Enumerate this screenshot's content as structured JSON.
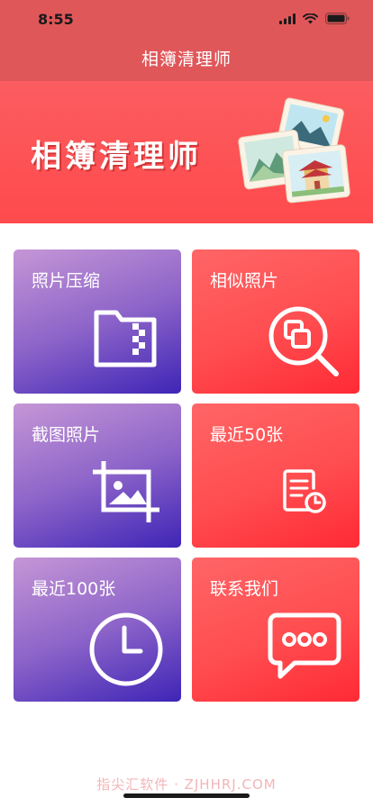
{
  "status_bar": {
    "time": "8:55"
  },
  "nav": {
    "title": "相簿清理师"
  },
  "banner": {
    "title": "相簿清理师"
  },
  "cards": [
    {
      "label": "照片压缩",
      "icon": "zip-folder-icon",
      "theme": "purple"
    },
    {
      "label": "相似照片",
      "icon": "similar-search-icon",
      "theme": "red"
    },
    {
      "label": "截图照片",
      "icon": "crop-image-icon",
      "theme": "purple"
    },
    {
      "label": "最近50张",
      "icon": "recent-document-icon",
      "theme": "red"
    },
    {
      "label": "最近100张",
      "icon": "clock-icon",
      "theme": "purple"
    },
    {
      "label": "联系我们",
      "icon": "chat-bubble-icon",
      "theme": "red"
    }
  ],
  "watermark": "指尖汇软件 · ZJHHRJ.COM",
  "colors": {
    "header": "#e0575a",
    "banner": "#ff4d50",
    "purple_start": "#c596d6",
    "purple_end": "#3e25b6",
    "red_start": "#ff6566",
    "red_end": "#ff2a35"
  }
}
